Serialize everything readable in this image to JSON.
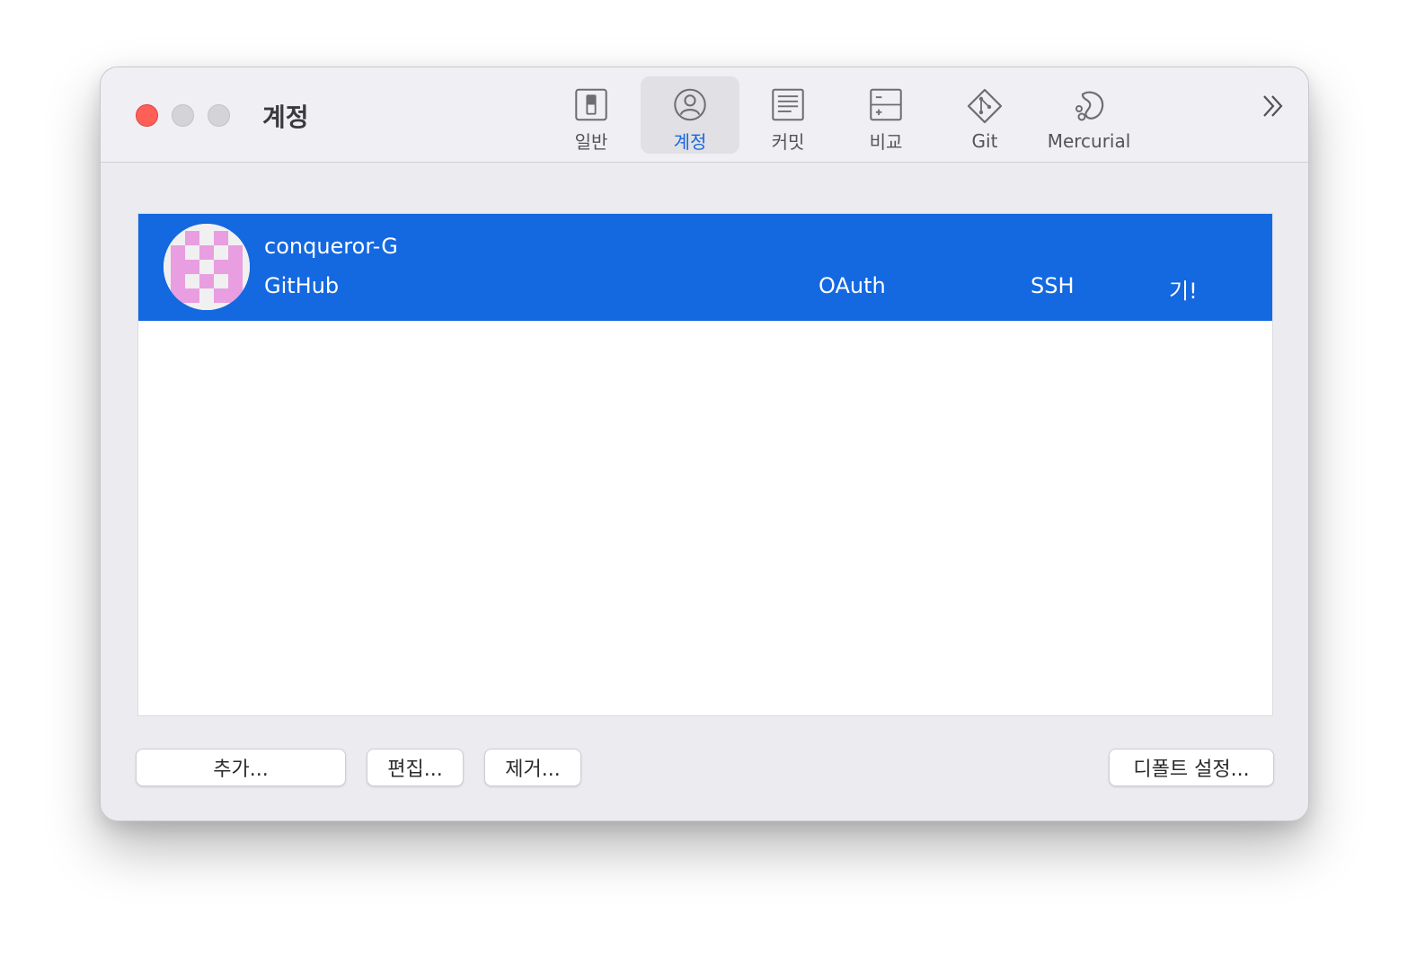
{
  "window": {
    "title": "계정"
  },
  "toolbar": {
    "tabs": [
      {
        "label": "일반",
        "icon": "switch-icon",
        "selected": false
      },
      {
        "label": "계정",
        "icon": "account-icon",
        "selected": true
      },
      {
        "label": "커밋",
        "icon": "commit-document-icon",
        "selected": false
      },
      {
        "label": "비교",
        "icon": "diff-icon",
        "selected": false
      },
      {
        "label": "Git",
        "icon": "git-icon",
        "selected": false
      },
      {
        "label": "Mercurial",
        "icon": "mercurial-icon",
        "selected": false
      }
    ],
    "overflow_icon": "chevron-double-right-icon"
  },
  "accounts": [
    {
      "username": "conqueror-G",
      "host": "GitHub",
      "auth": "OAuth",
      "protocol": "SSH",
      "default": "기!"
    }
  ],
  "buttons": {
    "add": "추가...",
    "edit": "편집...",
    "remove": "제거...",
    "set_default": "디폴트 설정..."
  },
  "colors": {
    "selection": "#1468e0",
    "accent": "#1a66dd",
    "close": "#fe5f57",
    "avatar_identicon": "#e89ee0"
  }
}
